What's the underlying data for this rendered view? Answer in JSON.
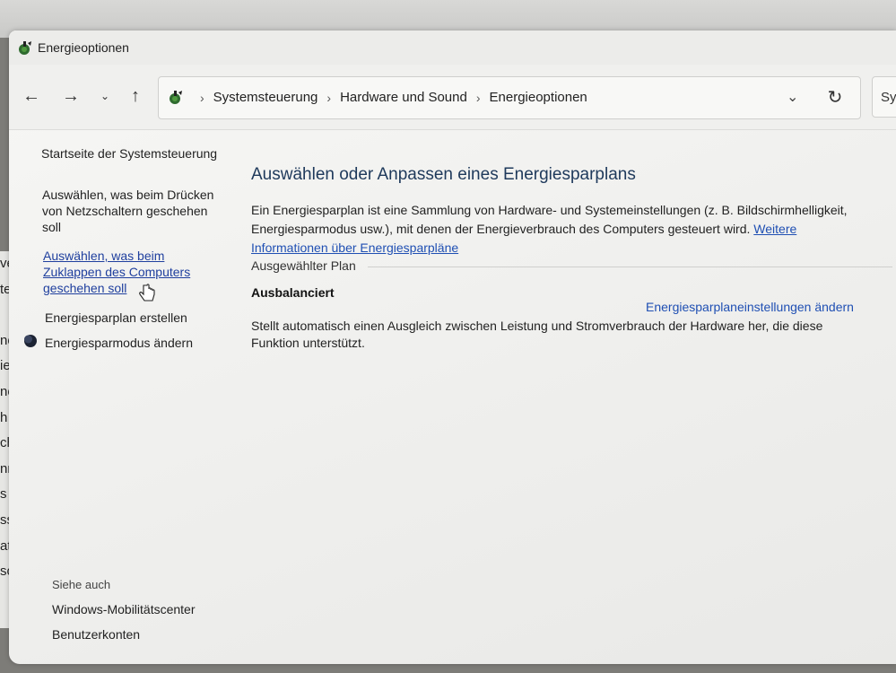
{
  "window": {
    "title": "Energieoptionen"
  },
  "background_fragments": [
    "ve",
    "te",
    "",
    "ne",
    "ies",
    "ne",
    "h e",
    "cht",
    "nn",
    "s z",
    "ss",
    "atio",
    "son"
  ],
  "navigation": {
    "back_icon": "arrow-left-icon",
    "forward_icon": "arrow-right-icon",
    "recent_icon": "chevron-down-icon",
    "up_icon": "arrow-up-icon"
  },
  "address": {
    "crumbs": [
      "Systemsteuerung",
      "Hardware und Sound",
      "Energieoptionen"
    ],
    "search_partial": "Sy"
  },
  "sidebar": {
    "home": "Startseite der Systemsteuerung",
    "power_button_lines": [
      "Auswählen, was beim Drücken",
      "von Netzschaltern geschehen",
      "soll"
    ],
    "lid_close_lines": [
      "Auswählen, was beim",
      "Zuklappen des Computers",
      "geschehen soll"
    ],
    "create_plan": "Energiesparplan erstellen",
    "power_mode": "Energiesparmodus ändern",
    "see_also": "Siehe auch",
    "mobility_center": "Windows-Mobilitätscenter",
    "user_accounts": "Benutzerkonten"
  },
  "main": {
    "heading": "Auswählen oder Anpassen eines Energiesparplans",
    "description_line1": "Ein Energiesparplan ist eine Sammlung von Hardware- und Systemeinstellungen (z. B. Bildschirmhelligkeit,",
    "description_line2": "Energiesparmodus usw.), mit denen der Energieverbrauch des Computers gesteuert wird.",
    "more_info_link_part1": "Weitere",
    "more_info_link_part2": "Informationen über Energiesparpläne",
    "selected_plan_label": "Ausgewählter Plan",
    "plan_name": "Ausbalanciert",
    "plan_settings_link": "Energiesparplaneinstellungen ändern",
    "plan_description_line1": "Stellt automatisch einen Ausgleich zwischen Leistung und Stromverbrauch der Hardware her, die diese",
    "plan_description_line2": "Funktion unterstützt."
  },
  "colors": {
    "link": "#1f4fb3",
    "heading": "#1e395b",
    "window_bg": "#f4f4f2"
  }
}
